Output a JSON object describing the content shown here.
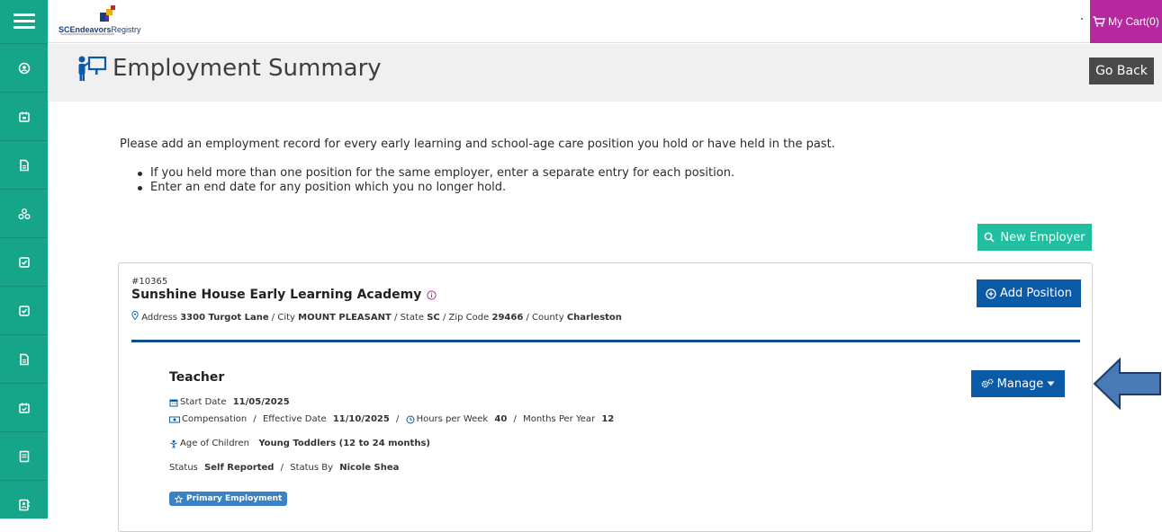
{
  "app": {
    "logo_text_bold": "SCEndeavors",
    "logo_text": "Registry",
    "cart_label": "My Cart(0)"
  },
  "colors": {
    "sidebar": "#17a589",
    "cart": "#b5289e",
    "primary_button": "#0b5aa8",
    "teal_button": "#1fbf9f",
    "divider": "#0f4c8a",
    "arrow": "#4a7ab5"
  },
  "sidebar": {
    "items": [
      {
        "icon": "user-circle-icon"
      },
      {
        "icon": "calendar-icon"
      },
      {
        "icon": "document-icon"
      },
      {
        "icon": "organization-icon"
      },
      {
        "icon": "checkbox-icon"
      },
      {
        "icon": "checkbox-icon"
      },
      {
        "icon": "document-icon"
      },
      {
        "icon": "calendar-check-icon"
      },
      {
        "icon": "list-icon"
      },
      {
        "icon": "contact-card-icon"
      }
    ]
  },
  "header": {
    "title": "Employment Summary",
    "go_back": "Go Back"
  },
  "intro": {
    "text": "Please add an employment record for every early learning and school-age care position you hold or have held in the past.",
    "bullets": [
      "If you held more than one position for the same employer, enter a separate entry for each position.",
      "Enter an end date for any position which you no longer hold."
    ]
  },
  "new_employer_label": "New Employer",
  "employer": {
    "id": "#10365",
    "name": "Sunshine House Early Learning Academy",
    "add_position_label": "Add Position",
    "address_label": "Address",
    "address": "3300 Turgot Lane",
    "city_label": "City",
    "city": "MOUNT PLEASANT",
    "state_label": "State",
    "state": "SC",
    "zip_label": "Zip Code",
    "zip": "29466",
    "county_label": "County",
    "county": "Charleston",
    "sep": "/"
  },
  "position": {
    "title": "Teacher",
    "manage_label": "Manage",
    "start_date_label": "Start Date",
    "start_date": "11/05/2025",
    "compensation_label": "Compensation",
    "effective_date_label": "Effective Date",
    "effective_date": "11/10/2025",
    "hours_label": "Hours per Week",
    "hours": "40",
    "months_label": "Months Per Year",
    "months": "12",
    "age_label": "Age of Children",
    "age": "Young Toddlers (12 to 24 months)",
    "status_label": "Status",
    "status": "Self Reported",
    "status_by_label": "Status By",
    "status_by": "Nicole Shea",
    "badge": "Primary Employment"
  }
}
